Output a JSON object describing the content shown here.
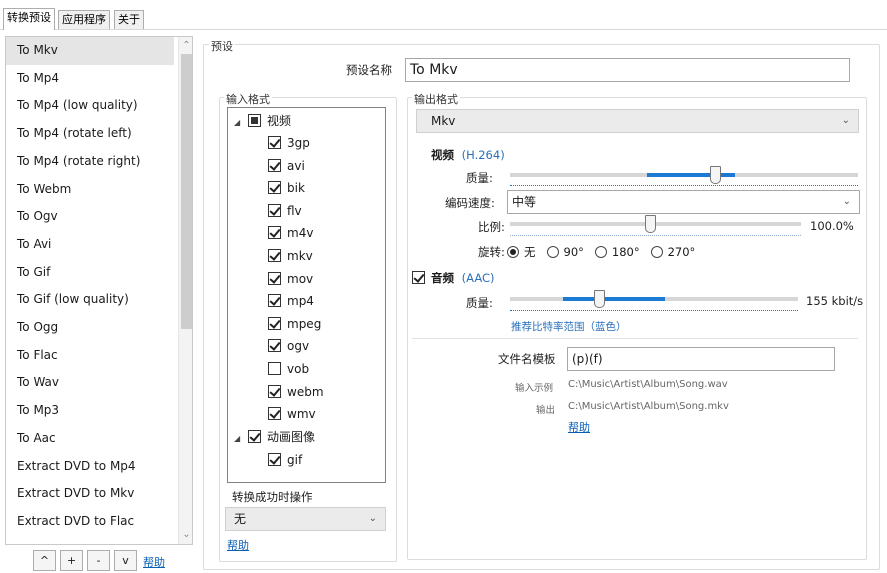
{
  "tabs": [
    {
      "label": "转换预设",
      "active": true
    },
    {
      "label": "应用程序",
      "active": false
    },
    {
      "label": "关于",
      "active": false
    }
  ],
  "presets": [
    "To Mkv",
    "To Mp4",
    "To Mp4 (low quality)",
    "To Mp4 (rotate left)",
    "To Mp4 (rotate right)",
    "To Webm",
    "To Ogv",
    "To Avi",
    "To Gif",
    "To Gif (low quality)",
    "To Ogg",
    "To Flac",
    "To Wav",
    "To Mp3",
    "To Aac",
    "Extract DVD to Mp4",
    "Extract DVD to Mkv",
    "Extract DVD to Flac"
  ],
  "list_buttons": {
    "up": "^",
    "add": "+",
    "remove": "-",
    "down": "v",
    "help": "帮助"
  },
  "preset": {
    "group_label": "预设",
    "name_label": "预设名称",
    "name_value": "To Mkv"
  },
  "input_format": {
    "group_label": "输入格式",
    "video_category": "视频",
    "video_formats": [
      {
        "name": "3gp",
        "checked": true
      },
      {
        "name": "avi",
        "checked": true
      },
      {
        "name": "bik",
        "checked": true
      },
      {
        "name": "flv",
        "checked": true
      },
      {
        "name": "m4v",
        "checked": true
      },
      {
        "name": "mkv",
        "checked": true
      },
      {
        "name": "mov",
        "checked": true
      },
      {
        "name": "mp4",
        "checked": true
      },
      {
        "name": "mpeg",
        "checked": true
      },
      {
        "name": "ogv",
        "checked": true
      },
      {
        "name": "vob",
        "checked": false
      },
      {
        "name": "webm",
        "checked": true
      },
      {
        "name": "wmv",
        "checked": true
      }
    ],
    "anim_category": "动画图像",
    "anim_formats": [
      {
        "name": "gif",
        "checked": true
      }
    ],
    "on_success_label": "转换成功时操作",
    "on_success_value": "无",
    "help": "帮助"
  },
  "output_format": {
    "group_label": "输出格式",
    "format_value": "Mkv",
    "video": {
      "label": "视频",
      "codec": "(H.264)",
      "quality_label": "质量:",
      "quality_fraction": 0.59,
      "speed_label": "编码速度:",
      "speed_value": "中等",
      "scale_label": "比例:",
      "scale_value": "100.0%",
      "scale_fraction": 0.48,
      "rotate_label": "旋转:",
      "rotate_options": [
        "无",
        "90°",
        "180°",
        "270°"
      ],
      "rotate_selected": 0
    },
    "audio": {
      "label": "音频",
      "codec": "(AAC)",
      "checked": true,
      "quality_label": "质量:",
      "quality_value": "155 kbit/s",
      "quality_fraction": 0.31,
      "hint": "推荐比特率范围（蓝色）"
    },
    "filename_template_label": "文件名模板",
    "filename_template_value": "(p)(f)",
    "input_example_label": "输入示例",
    "input_example_value": "C:\\Music\\Artist\\Album\\Song.wav",
    "output_label": "输出",
    "output_value": "C:\\Music\\Artist\\Album\\Song.mkv",
    "help": "帮助"
  },
  "colors": {
    "accent": "#1a7ad4",
    "link": "#0a5fb4"
  }
}
